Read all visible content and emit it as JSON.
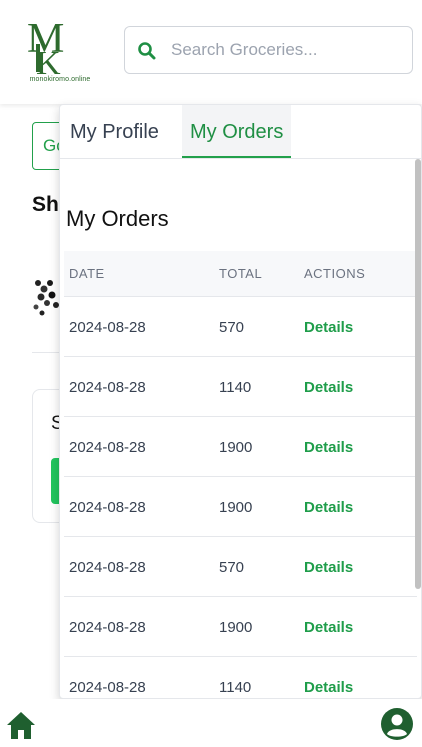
{
  "brand": {
    "logo_text": "MK",
    "logo_caption": "monokiromo.online",
    "color": "#2e6b2e"
  },
  "search": {
    "placeholder": "Search Groceries...",
    "icon": "search-icon"
  },
  "background": {
    "button_label": "Go",
    "heading": "Sh",
    "card_text": "S"
  },
  "panel": {
    "tabs": [
      {
        "label": "My Profile",
        "active": false
      },
      {
        "label": "My Orders",
        "active": true
      }
    ],
    "title": "My Orders",
    "columns": {
      "date": "DATE",
      "total": "TOTAL",
      "actions": "ACTIONS"
    },
    "orders": [
      {
        "date": "2024-08-28",
        "total": "570",
        "action": "Details"
      },
      {
        "date": "2024-08-28",
        "total": "1140",
        "action": "Details"
      },
      {
        "date": "2024-08-28",
        "total": "1900",
        "action": "Details"
      },
      {
        "date": "2024-08-28",
        "total": "1900",
        "action": "Details"
      },
      {
        "date": "2024-08-28",
        "total": "570",
        "action": "Details"
      },
      {
        "date": "2024-08-28",
        "total": "1900",
        "action": "Details"
      },
      {
        "date": "2024-08-28",
        "total": "1140",
        "action": "Details"
      }
    ]
  },
  "bottom_nav": {
    "home_icon": "home-icon",
    "profile_icon": "user-circle-icon"
  },
  "colors": {
    "accent": "#22a04b",
    "link": "#1f9d4a",
    "nav_icon": "#1f5f2f"
  }
}
